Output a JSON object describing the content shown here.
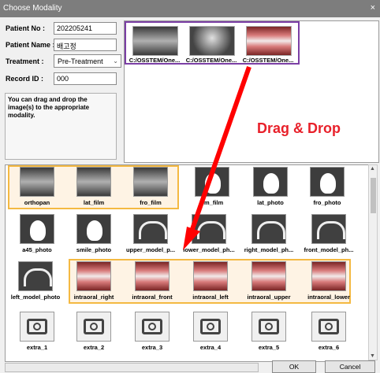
{
  "window": {
    "title": "Choose Modality",
    "close_glyph": "×"
  },
  "patient": {
    "no_label": "Patient No :",
    "no_value": "202205241",
    "name_label": "Patient Name :",
    "name_value": "배고정",
    "treatment_label": "Treatment :",
    "treatment_value": "Pre-Treatment",
    "record_label": "Record ID :",
    "record_value": "000"
  },
  "instructions": "You can drag and drop the image(s) to the appropriate modality.",
  "source_images": [
    {
      "caption": "C:/OSSTEM/One...",
      "kind": "xray"
    },
    {
      "caption": "C:/OSSTEM/One...",
      "kind": "xray"
    },
    {
      "caption": "C:/OSSTEM/One...",
      "kind": "teeth"
    }
  ],
  "overlay": {
    "text": "Drag & Drop",
    "color": "#e8202a"
  },
  "modalities": [
    {
      "caption": "orthopan",
      "kind": "xray"
    },
    {
      "caption": "lat_film",
      "kind": "xray"
    },
    {
      "caption": "fro_film",
      "kind": "xray"
    },
    {
      "caption": "sm_film",
      "kind": "photo"
    },
    {
      "caption": "lat_photo",
      "kind": "photo"
    },
    {
      "caption": "fro_photo",
      "kind": "photo"
    },
    {
      "caption": "a45_photo",
      "kind": "photo"
    },
    {
      "caption": "smile_photo",
      "kind": "photo"
    },
    {
      "caption": "upper_model_p...",
      "kind": "model"
    },
    {
      "caption": "lower_model_ph...",
      "kind": "model"
    },
    {
      "caption": "right_model_ph...",
      "kind": "model"
    },
    {
      "caption": "front_model_ph...",
      "kind": "model"
    },
    {
      "caption": "left_model_photo",
      "kind": "model"
    },
    {
      "caption": "intraoral_right",
      "kind": "teeth"
    },
    {
      "caption": "intraoral_front",
      "kind": "teeth"
    },
    {
      "caption": "intraoral_left",
      "kind": "teeth"
    },
    {
      "caption": "intraoral_upper",
      "kind": "teeth"
    },
    {
      "caption": "intraoral_lower",
      "kind": "teeth"
    },
    {
      "caption": "extra_1",
      "kind": "extra"
    },
    {
      "caption": "extra_2",
      "kind": "extra"
    },
    {
      "caption": "extra_3",
      "kind": "extra"
    },
    {
      "caption": "extra_4",
      "kind": "extra"
    },
    {
      "caption": "extra_5",
      "kind": "extra"
    },
    {
      "caption": "extra_6",
      "kind": "extra"
    }
  ],
  "buttons": {
    "ok": "OK",
    "cancel": "Cancel"
  },
  "colors": {
    "drag_source_border": "#7b3fa5",
    "group_highlight": "#f4b942",
    "arrow": "#ff0000"
  }
}
